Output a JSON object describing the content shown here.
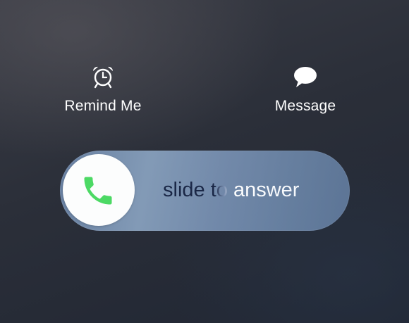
{
  "actions": {
    "remind": {
      "label": "Remind Me",
      "icon": "alarm-clock-icon"
    },
    "message": {
      "label": "Message",
      "icon": "speech-bubble-icon"
    }
  },
  "slider": {
    "text": "slide to answer",
    "knob_icon": "phone-icon"
  },
  "colors": {
    "phone_green": "#4cd964",
    "knob_white": "#fcfdfd",
    "text_dark": "#1a2746",
    "text_light": "#ffffff"
  }
}
